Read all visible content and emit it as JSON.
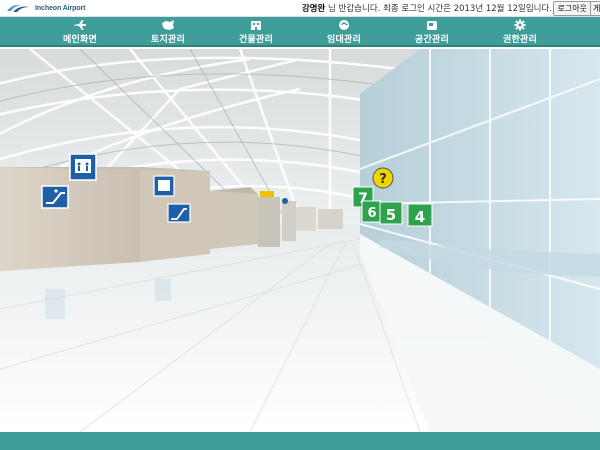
{
  "header": {
    "logo_text": "Incheon Airport",
    "user_name": "강명완",
    "greeting_rest": "님 반갑습니다. 최종 로그인 시간은 2013년 12월 12일입니다.",
    "logout_label": "로그아웃",
    "clipped_button_label": "게"
  },
  "nav": {
    "items": [
      {
        "label": "메인화면",
        "icon": "airplane-icon"
      },
      {
        "label": "토지관리",
        "icon": "land-map-icon"
      },
      {
        "label": "건물관리",
        "icon": "building-icon"
      },
      {
        "label": "임대관리",
        "icon": "lease-icon"
      },
      {
        "label": "공간관리",
        "icon": "space-icon"
      },
      {
        "label": "권한관리",
        "icon": "gear-icon"
      }
    ]
  },
  "scene": {
    "help_marker": "?",
    "gate_signs": [
      "7",
      "6",
      "5",
      "4"
    ],
    "colors": {
      "teal": "#3f9e9a",
      "sign_green": "#2ea24d",
      "sign_blue": "#1f5fa8",
      "help_yellow": "#f1d400"
    }
  }
}
